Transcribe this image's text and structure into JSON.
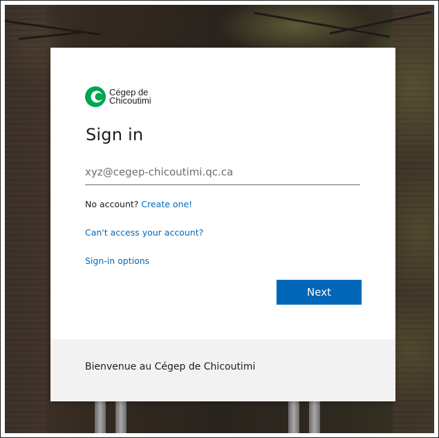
{
  "brand": {
    "line1": "Cégep de",
    "line2": "Chicoutimi",
    "accent": "#00a651"
  },
  "signin": {
    "title": "Sign in",
    "email_placeholder": "xyz@cegep-chicoutimi.qc.ca",
    "email_value": "",
    "no_account_text": "No account?",
    "create_link": "Create one!",
    "cant_access_link": "Can't access your account?",
    "options_link": "Sign-in options",
    "next_label": "Next",
    "button_color": "#0067b8",
    "link_color": "#0067b8"
  },
  "footer": {
    "text": "Bienvenue au Cégep de Chicoutimi"
  }
}
